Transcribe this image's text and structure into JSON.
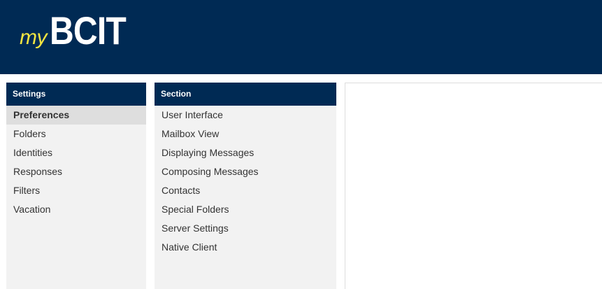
{
  "brand": {
    "my": "my",
    "name": "BCIT"
  },
  "colors": {
    "header_bg": "#002a54",
    "logo_my": "#f2e541",
    "panel_bg": "#f2f2f2",
    "selected_bg": "#dedede"
  },
  "settings": {
    "title": "Settings",
    "items": [
      {
        "label": "Preferences",
        "selected": true
      },
      {
        "label": "Folders"
      },
      {
        "label": "Identities"
      },
      {
        "label": "Responses"
      },
      {
        "label": "Filters"
      },
      {
        "label": "Vacation"
      }
    ]
  },
  "section": {
    "title": "Section",
    "items": [
      {
        "label": "User Interface"
      },
      {
        "label": "Mailbox View"
      },
      {
        "label": "Displaying Messages"
      },
      {
        "label": "Composing Messages"
      },
      {
        "label": "Contacts"
      },
      {
        "label": "Special Folders"
      },
      {
        "label": "Server Settings"
      },
      {
        "label": "Native Client"
      }
    ]
  }
}
